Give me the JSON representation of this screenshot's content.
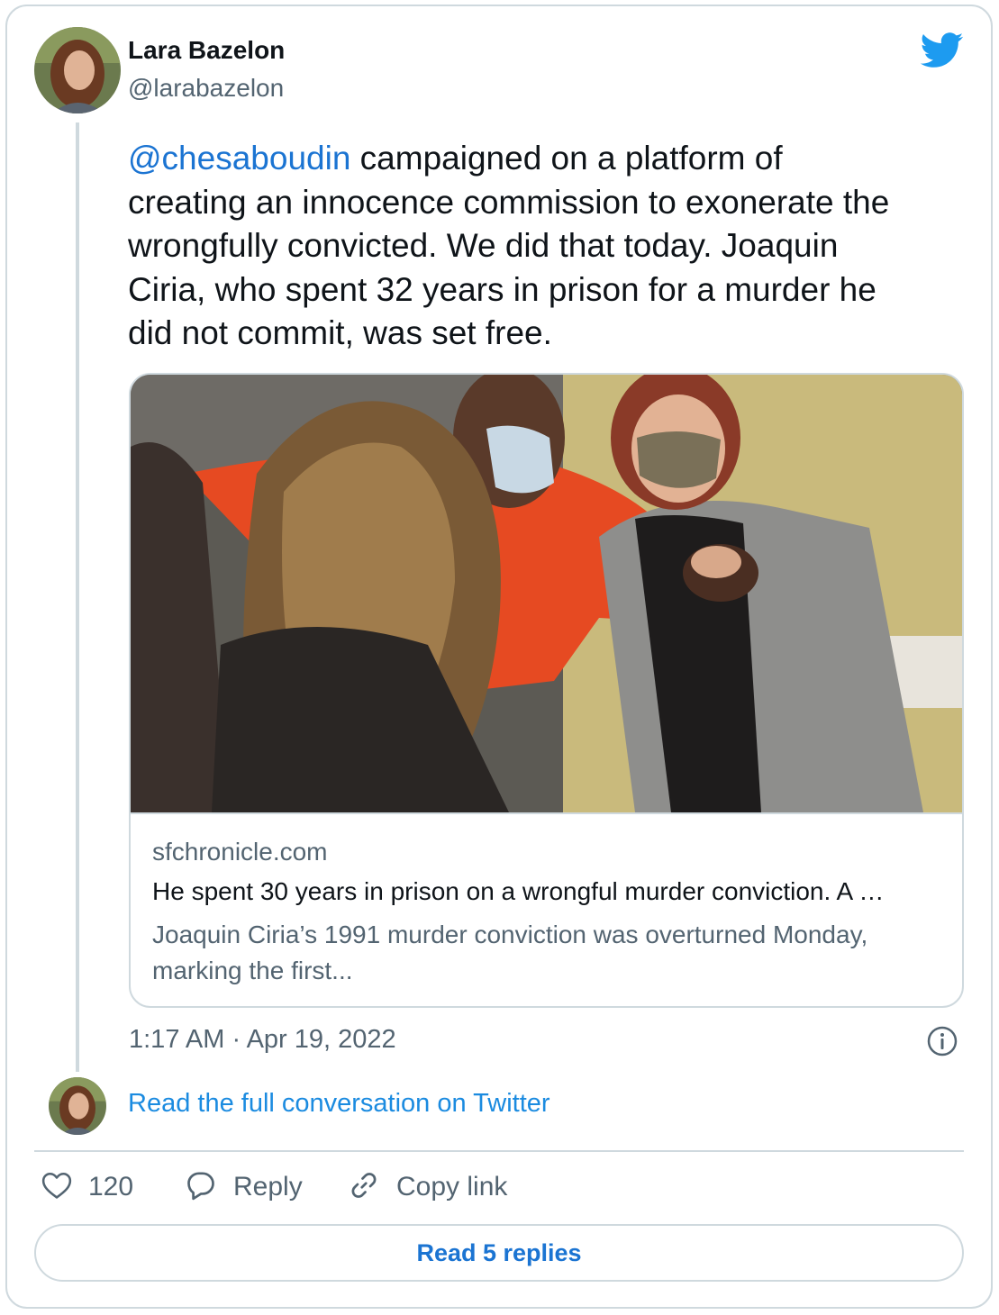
{
  "author": {
    "name": "Lara Bazelon",
    "handle": "@larabazelon"
  },
  "tweet": {
    "mention": "@chesaboudin",
    "text": " campaigned on a platform of\ncreating an innocence commission to exonerate the\nwrongfully convicted.  We did that today.  Joaquin\nCiria, who spent 32 years in prison for a murder he\ndid not commit, was set free."
  },
  "link_card": {
    "domain": "sfchronicle.com",
    "title": "He spent 30 years in prison on a wrongful murder conviction. A …",
    "description": "Joaquin Ciria’s 1991 murder conviction was overturned Monday, marking the first..."
  },
  "timestamp": "1:17 AM · Apr 19, 2022",
  "read_conversation": "Read the full conversation on Twitter",
  "actions": {
    "like_count": "120",
    "reply_label": "Reply",
    "copy_label": "Copy link"
  },
  "read_replies": "Read 5 replies",
  "colors": {
    "twitter_blue": "#1d9bf0",
    "link_blue": "#1b74d2",
    "muted_text": "#536471",
    "border": "#cfd9de"
  }
}
